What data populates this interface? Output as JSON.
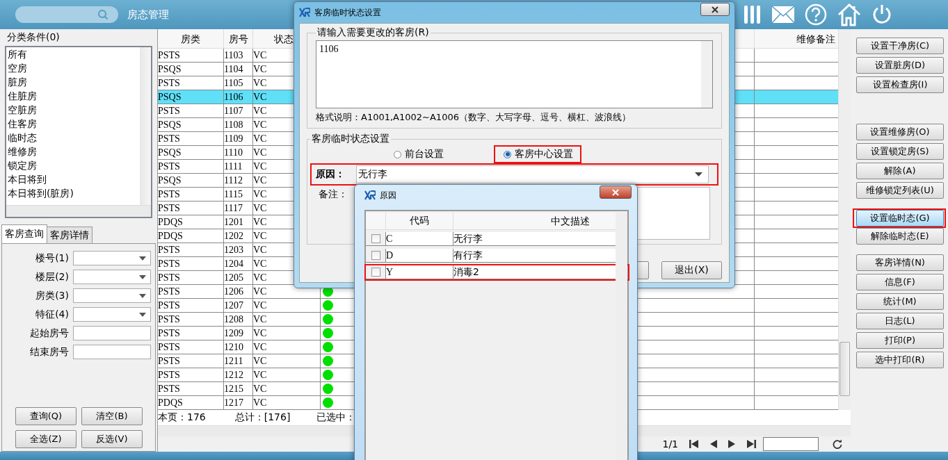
{
  "header": {
    "title": "房态管理"
  },
  "filter": {
    "title": "分类条件(0)",
    "items": [
      "所有",
      "空房",
      "脏房",
      "住脏房",
      "空脏房",
      "住客房",
      "临时态",
      "维修房",
      "锁定房",
      "本日将到",
      "本日将到(脏房)"
    ]
  },
  "tabs": [
    {
      "label": "客房查询",
      "selected": true
    },
    {
      "label": "客房详情",
      "selected": false
    }
  ],
  "query_fields": [
    {
      "label": "楼号(1)",
      "kind": "dropdown"
    },
    {
      "label": "楼层(2)",
      "kind": "dropdown"
    },
    {
      "label": "房类(3)",
      "kind": "dropdown"
    },
    {
      "label": "特征(4)",
      "kind": "dropdown"
    },
    {
      "label": "起始房号",
      "kind": "text"
    },
    {
      "label": "结束房号",
      "kind": "text"
    }
  ],
  "query_buttons": [
    "查询(Q)",
    "清空(B)",
    "全选(Z)",
    "反选(V)"
  ],
  "grid": {
    "columns": [
      "房类",
      "房号",
      "状态",
      "维修备注"
    ],
    "rows": [
      {
        "type": "PSTS",
        "room": "1103",
        "status": "VC",
        "selected": false
      },
      {
        "type": "PSQS",
        "room": "1104",
        "status": "VC",
        "selected": false
      },
      {
        "type": "PSTS",
        "room": "1105",
        "status": "VC",
        "selected": false
      },
      {
        "type": "PSQS",
        "room": "1106",
        "status": "VC",
        "selected": true
      },
      {
        "type": "PSTS",
        "room": "1107",
        "status": "VC",
        "selected": false
      },
      {
        "type": "PSQS",
        "room": "1108",
        "status": "VC",
        "selected": false
      },
      {
        "type": "PSTS",
        "room": "1109",
        "status": "VC",
        "selected": false
      },
      {
        "type": "PSQS",
        "room": "1110",
        "status": "VC",
        "selected": false
      },
      {
        "type": "PSTS",
        "room": "1111",
        "status": "VC",
        "selected": false
      },
      {
        "type": "PSQS",
        "room": "1112",
        "status": "VC",
        "selected": false
      },
      {
        "type": "PSTS",
        "room": "1115",
        "status": "VC",
        "selected": false
      },
      {
        "type": "PSTS",
        "room": "1117",
        "status": "VC",
        "selected": false
      },
      {
        "type": "PDQS",
        "room": "1201",
        "status": "VC",
        "selected": false
      },
      {
        "type": "PDQS",
        "room": "1202",
        "status": "VC",
        "selected": false
      },
      {
        "type": "PSTS",
        "room": "1203",
        "status": "VC",
        "selected": false
      },
      {
        "type": "PSTS",
        "room": "1204",
        "status": "VC",
        "selected": false
      },
      {
        "type": "PSTS",
        "room": "1205",
        "status": "VC",
        "selected": false
      },
      {
        "type": "PSTS",
        "room": "1206",
        "status": "VC",
        "selected": false,
        "dot": true
      },
      {
        "type": "PSTS",
        "room": "1207",
        "status": "VC",
        "selected": false,
        "dot": true
      },
      {
        "type": "PSTS",
        "room": "1208",
        "status": "VC",
        "selected": false,
        "dot": true
      },
      {
        "type": "PSTS",
        "room": "1209",
        "status": "VC",
        "selected": false,
        "dot": true
      },
      {
        "type": "PSTS",
        "room": "1210",
        "status": "VC",
        "selected": false,
        "dot": true
      },
      {
        "type": "PSTS",
        "room": "1211",
        "status": "VC",
        "selected": false,
        "dot": true
      },
      {
        "type": "PSTS",
        "room": "1212",
        "status": "VC",
        "selected": false,
        "dot": true
      },
      {
        "type": "PSTS",
        "room": "1215",
        "status": "VC",
        "selected": false,
        "dot": true
      },
      {
        "type": "PDQS",
        "room": "1217",
        "status": "VC",
        "selected": false,
        "dot": true
      }
    ]
  },
  "footer": {
    "page_count": "本页：176",
    "total": "总计：[176]",
    "selected": "已选中："
  },
  "pager": {
    "page": "1/1"
  },
  "side_button_groups": [
    [
      {
        "label": "设置干净房(C)",
        "selected": false,
        "marked": false
      },
      {
        "label": "设置脏房(D)",
        "selected": false,
        "marked": false
      },
      {
        "label": "设置检查房(I)",
        "selected": false,
        "marked": false
      }
    ],
    [
      {
        "label": "设置维修房(O)",
        "selected": false,
        "marked": false
      },
      {
        "label": "设置锁定房(S)",
        "selected": false,
        "marked": false
      },
      {
        "label": "解除(A)",
        "selected": false,
        "marked": false
      },
      {
        "label": "维修锁定列表(U)",
        "selected": false,
        "marked": false
      }
    ],
    [
      {
        "label": "设置临时态(G)",
        "selected": true,
        "marked": true
      },
      {
        "label": "解除临时态(E)",
        "selected": false,
        "marked": false
      }
    ],
    [
      {
        "label": "客房详情(N)",
        "selected": false,
        "marked": false
      },
      {
        "label": "信息(F)",
        "selected": false,
        "marked": false
      },
      {
        "label": "统计(M)",
        "selected": false,
        "marked": false
      },
      {
        "label": "日志(L)",
        "selected": false,
        "marked": false
      },
      {
        "label": "打印(P)",
        "selected": false,
        "marked": false
      },
      {
        "label": "选中打印(R)",
        "selected": false,
        "marked": false
      }
    ]
  ],
  "temp_dialog": {
    "title": "客房临时状态设置",
    "rooms": {
      "title": "请输入需要更改的客房(R)",
      "value": "1106",
      "note": "格式说明：A1001,A1002~A1006（数字、大写字母、逗号、横杠、波浪线）"
    },
    "status": {
      "title": "客房临时状态设置",
      "radios": [
        {
          "label": "前台设置",
          "selected": false,
          "marked": false
        },
        {
          "label": "客房中心设置",
          "selected": true,
          "marked": true
        }
      ],
      "reason": {
        "label": "原因：",
        "value": "无行李",
        "marked": true
      },
      "remark": {
        "label": "备注："
      }
    },
    "buttons": [
      "退出(X)"
    ]
  },
  "reason_dialog": {
    "title": "原因",
    "columns": [
      "代码",
      "中文描述"
    ],
    "rows": [
      {
        "code": "C",
        "description": "无行李",
        "checked": false,
        "marked": false
      },
      {
        "code": "D",
        "description": "有行李",
        "checked": false,
        "marked": false
      },
      {
        "code": "Y",
        "description": "消毒2",
        "checked": false,
        "marked": true
      }
    ]
  }
}
